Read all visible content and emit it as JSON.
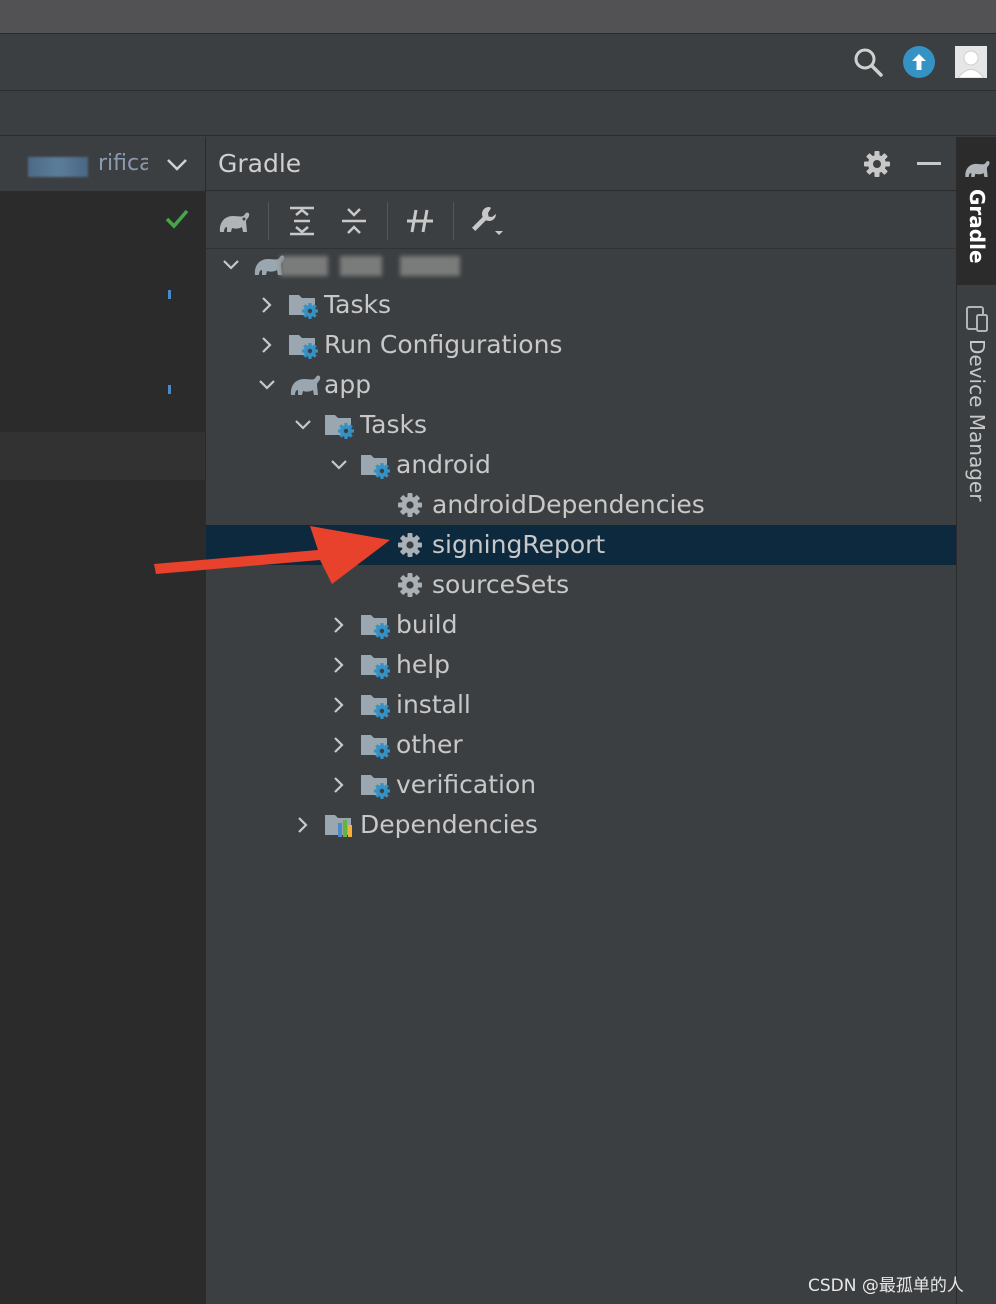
{
  "topbar": {
    "icons": [
      "search-icon",
      "update-icon",
      "user-avatar-icon"
    ],
    "accent": "#3592c4"
  },
  "left_panel": {
    "tab_text": "rifica"
  },
  "gradle": {
    "title": "Gradle",
    "toolbar": [
      "gradle-elephant-icon",
      "expand-all-icon",
      "collapse-all-icon",
      "toggle-offline-icon",
      "build-tool-settings-icon"
    ],
    "tree": [
      {
        "label": "",
        "depth": 0,
        "expanded": true,
        "icon": "gradle-project-icon",
        "blurred": true
      },
      {
        "label": "Tasks",
        "depth": 1,
        "expanded": false,
        "icon": "task-folder-icon"
      },
      {
        "label": "Run Configurations",
        "depth": 1,
        "expanded": false,
        "icon": "task-folder-icon"
      },
      {
        "label": "app",
        "depth": 1,
        "expanded": true,
        "icon": "gradle-module-icon"
      },
      {
        "label": "Tasks",
        "depth": 2,
        "expanded": true,
        "icon": "task-folder-icon"
      },
      {
        "label": "android",
        "depth": 3,
        "expanded": true,
        "icon": "task-folder-icon"
      },
      {
        "label": "androidDependencies",
        "depth": 4,
        "leaf": true,
        "icon": "gear-icon"
      },
      {
        "label": "signingReport",
        "depth": 4,
        "leaf": true,
        "icon": "gear-icon",
        "selected": true
      },
      {
        "label": "sourceSets",
        "depth": 4,
        "leaf": true,
        "icon": "gear-icon"
      },
      {
        "label": "build",
        "depth": 3,
        "expanded": false,
        "icon": "task-folder-icon"
      },
      {
        "label": "help",
        "depth": 3,
        "expanded": false,
        "icon": "task-folder-icon"
      },
      {
        "label": "install",
        "depth": 3,
        "expanded": false,
        "icon": "task-folder-icon"
      },
      {
        "label": "other",
        "depth": 3,
        "expanded": false,
        "icon": "task-folder-icon"
      },
      {
        "label": "verification",
        "depth": 3,
        "expanded": false,
        "icon": "task-folder-icon"
      },
      {
        "label": "Dependencies",
        "depth": 2,
        "expanded": false,
        "icon": "dependencies-icon"
      }
    ]
  },
  "right_strip": {
    "gradle_tab": "Gradle",
    "device_manager_tab": "Device Manager"
  },
  "annotation": {
    "arrow_color": "#e8412c"
  },
  "watermark": "CSDN @最孤单的人"
}
